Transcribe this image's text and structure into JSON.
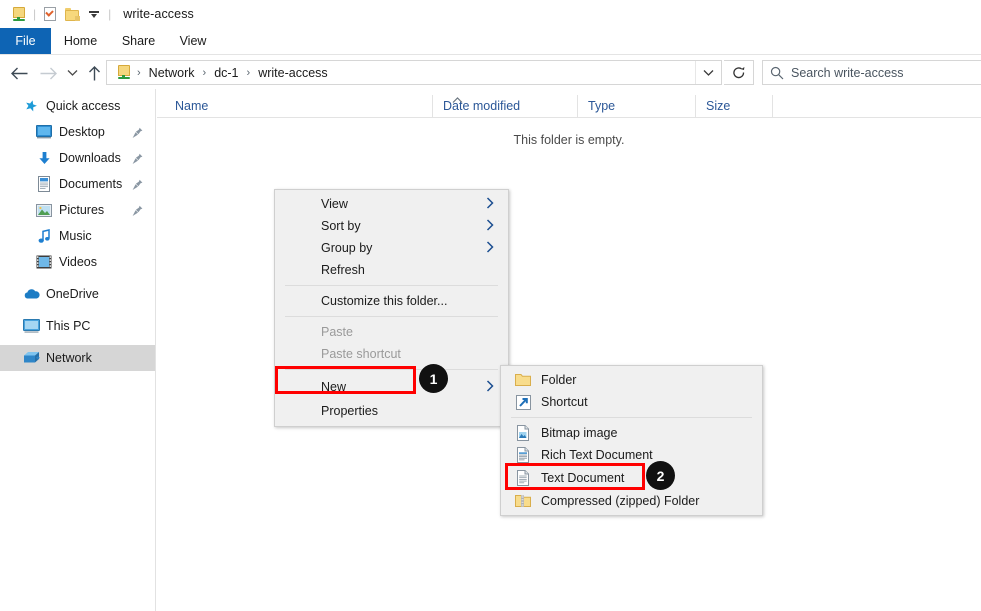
{
  "window": {
    "title": "write-access",
    "quick_access_toolbar": [
      {
        "name": "network-drive-icon",
        "label": "Network drive"
      },
      {
        "name": "properties-icon",
        "label": "Properties"
      },
      {
        "name": "new-folder-icon",
        "label": "New folder"
      },
      {
        "name": "customize-dropdown-icon",
        "label": "Customize Quick Access Toolbar"
      }
    ]
  },
  "ribbon": {
    "tabs": [
      {
        "label": "File",
        "active": true
      },
      {
        "label": "Home",
        "active": false
      },
      {
        "label": "Share",
        "active": false
      },
      {
        "label": "View",
        "active": false
      }
    ]
  },
  "navigation": {
    "back_label": "Back",
    "forward_label": "Forward",
    "recent_label": "Recent locations",
    "up_label": "Up one level",
    "refresh_label": "Refresh",
    "breadcrumb": [
      "Network",
      "dc-1",
      "write-access"
    ],
    "breadcrumb_separator": "›"
  },
  "search": {
    "placeholder": "Search write-access",
    "icon": "search-icon"
  },
  "sidebar": {
    "items": [
      {
        "label": "Quick access",
        "icon": "star-pin-icon",
        "indent": false,
        "pinned": false,
        "selected": false
      },
      {
        "label": "Desktop",
        "icon": "desktop-icon",
        "indent": true,
        "pinned": true,
        "selected": false
      },
      {
        "label": "Downloads",
        "icon": "downloads-icon",
        "indent": true,
        "pinned": true,
        "selected": false
      },
      {
        "label": "Documents",
        "icon": "documents-icon",
        "indent": true,
        "pinned": true,
        "selected": false
      },
      {
        "label": "Pictures",
        "icon": "pictures-icon",
        "indent": true,
        "pinned": true,
        "selected": false
      },
      {
        "label": "Music",
        "icon": "music-icon",
        "indent": true,
        "pinned": false,
        "selected": false
      },
      {
        "label": "Videos",
        "icon": "videos-icon",
        "indent": true,
        "pinned": false,
        "selected": false
      },
      {
        "label": "OneDrive",
        "icon": "onedrive-cloud-icon",
        "indent": false,
        "pinned": false,
        "selected": false
      },
      {
        "label": "This PC",
        "icon": "this-pc-icon",
        "indent": false,
        "pinned": false,
        "selected": false
      },
      {
        "label": "Network",
        "icon": "network-icon",
        "indent": false,
        "pinned": false,
        "selected": true
      }
    ]
  },
  "file_list": {
    "columns": [
      {
        "label": "Name",
        "sorted": true,
        "sort_direction": "ascending"
      },
      {
        "label": "Date modified",
        "sorted": false
      },
      {
        "label": "Type",
        "sorted": false
      },
      {
        "label": "Size",
        "sorted": false
      }
    ],
    "empty_message": "This folder is empty.",
    "rows": []
  },
  "context_menu": {
    "items": [
      {
        "label": "View",
        "submenu": true,
        "disabled": false,
        "separator_after": false
      },
      {
        "label": "Sort by",
        "submenu": true,
        "disabled": false,
        "separator_after": false
      },
      {
        "label": "Group by",
        "submenu": true,
        "disabled": false,
        "separator_after": false
      },
      {
        "label": "Refresh",
        "submenu": false,
        "disabled": false,
        "separator_after": true
      },
      {
        "label": "Customize this folder...",
        "submenu": false,
        "disabled": false,
        "separator_after": true
      },
      {
        "label": "Paste",
        "submenu": false,
        "disabled": true,
        "separator_after": false
      },
      {
        "label": "Paste shortcut",
        "submenu": false,
        "disabled": true,
        "separator_after": true
      },
      {
        "label": "New",
        "submenu": true,
        "disabled": false,
        "separator_after": false,
        "highlighted": true
      },
      {
        "label": "Properties",
        "submenu": false,
        "disabled": false,
        "separator_after": false
      }
    ]
  },
  "new_submenu": {
    "items": [
      {
        "label": "Folder",
        "icon": "folder-icon",
        "separator_after": false
      },
      {
        "label": "Shortcut",
        "icon": "shortcut-icon",
        "separator_after": true
      },
      {
        "label": "Bitmap image",
        "icon": "bitmap-image-icon",
        "separator_after": false
      },
      {
        "label": "Rich Text Document",
        "icon": "rich-text-document-icon",
        "separator_after": false
      },
      {
        "label": "Text Document",
        "icon": "text-document-icon",
        "separator_after": false,
        "highlighted": true
      },
      {
        "label": "Compressed (zipped) Folder",
        "icon": "zipped-folder-icon",
        "separator_after": false
      }
    ]
  },
  "annotations": {
    "highlight_color": "#ff0000",
    "badge_color": "#111111",
    "steps": [
      {
        "number": "1",
        "target": "New"
      },
      {
        "number": "2",
        "target": "Text Document"
      }
    ]
  }
}
